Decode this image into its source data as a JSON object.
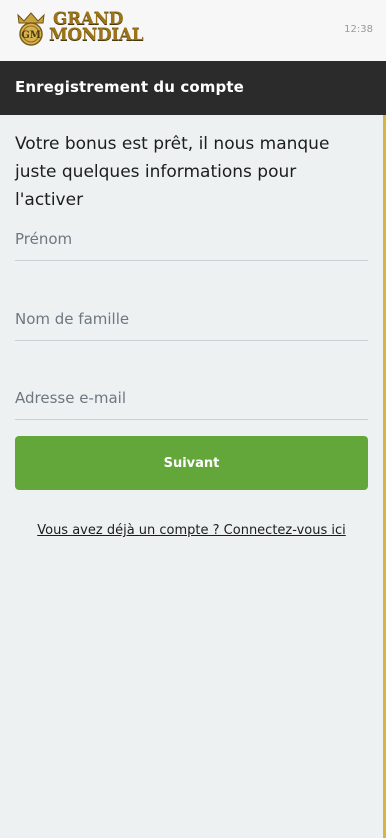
{
  "app": {
    "brand_line1": "GRAND",
    "brand_line2": "MONDIAL",
    "brand_mark": "GM",
    "status_time": "12:38"
  },
  "header": {
    "title": "Enregistrement du compte"
  },
  "form": {
    "intro": "Votre bonus est prêt, il nous manque juste quelques informations pour l'activer",
    "first_name_placeholder": "Prénom",
    "last_name_placeholder": "Nom de famille",
    "email_placeholder": "Adresse e-mail",
    "submit_label": "Suivant",
    "login_link": "Vous avez déjà un compte ? Connectez-vous ici"
  },
  "colors": {
    "header_background": "#2c2b2b",
    "button_background": "#63a73a",
    "brand_gold": "#9b7418",
    "page_background": "#eef1f2"
  },
  "icons": {
    "brand_logo": "crest-icon"
  }
}
